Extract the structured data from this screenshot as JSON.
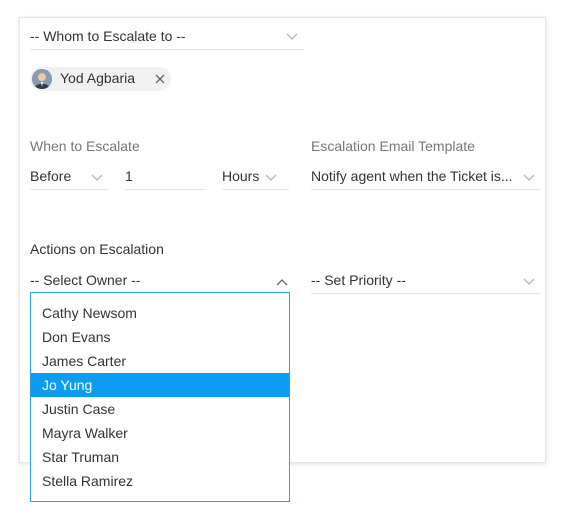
{
  "escalate_to": {
    "placeholder": "-- Whom to Escalate to --"
  },
  "assignee_chip": {
    "name": "Yod Agbaria",
    "remove_icon": "close-icon"
  },
  "when_section": {
    "label": "When to Escalate",
    "timing": "Before",
    "amount": "1",
    "unit": "Hours"
  },
  "template_section": {
    "label": "Escalation Email Template",
    "value": "Notify agent when the Ticket is..."
  },
  "actions_section": {
    "label": "Actions on Escalation",
    "owner_placeholder": "-- Select Owner --",
    "priority_placeholder": "-- Set Priority --"
  },
  "owner_dropdown": {
    "items": [
      {
        "label": "Cathy Newsom",
        "active": false
      },
      {
        "label": "Don Evans",
        "active": false
      },
      {
        "label": "James Carter",
        "active": false
      },
      {
        "label": "Jo Yung",
        "active": true
      },
      {
        "label": "Justin Case",
        "active": false
      },
      {
        "label": "Mayra Walker",
        "active": false
      },
      {
        "label": "Star Truman",
        "active": false
      },
      {
        "label": "Stella Ramirez",
        "active": false
      }
    ]
  },
  "colors": {
    "accent": "#0c9cf2",
    "dropdown_border": "#2aa1f0",
    "label_gray": "#777777",
    "text": "#333333"
  }
}
